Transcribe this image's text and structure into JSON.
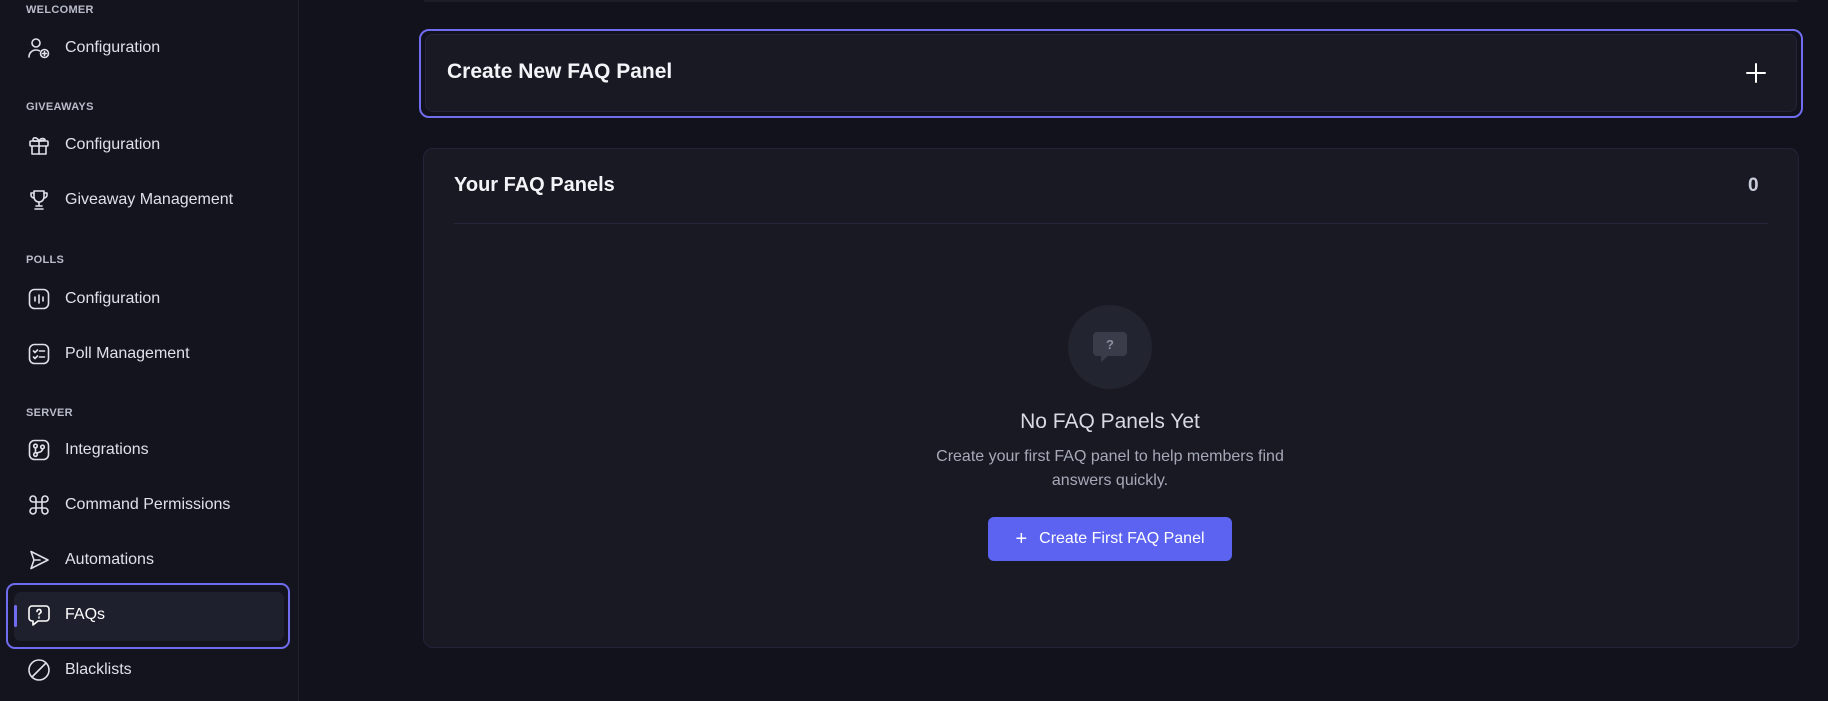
{
  "sidebar": {
    "sections": [
      {
        "label": "WELCOMER",
        "items": [
          {
            "label": "Configuration",
            "icon": "user-plus-icon"
          }
        ]
      },
      {
        "label": "GIVEAWAYS",
        "items": [
          {
            "label": "Configuration",
            "icon": "gift-icon"
          },
          {
            "label": "Giveaway Management",
            "icon": "trophy-icon"
          }
        ]
      },
      {
        "label": "POLLS",
        "items": [
          {
            "label": "Configuration",
            "icon": "poll-icon"
          },
          {
            "label": "Poll Management",
            "icon": "checklist-icon"
          }
        ]
      },
      {
        "label": "SERVER",
        "items": [
          {
            "label": "Integrations",
            "icon": "git-branch-icon"
          },
          {
            "label": "Command Permissions",
            "icon": "command-icon"
          },
          {
            "label": "Automations",
            "icon": "send-icon"
          },
          {
            "label": "FAQs",
            "icon": "faq-bubble-icon",
            "active": true
          },
          {
            "label": "Blacklists",
            "icon": "ban-icon"
          }
        ]
      }
    ]
  },
  "main": {
    "create_panel": {
      "title": "Create New FAQ Panel",
      "action_icon": "plus-icon"
    },
    "panels": {
      "title": "Your FAQ Panels",
      "count": "0",
      "empty_state": {
        "icon": "question-bubble-icon",
        "title": "No FAQ Panels Yet",
        "description_line1": "Create your first FAQ panel to help members find",
        "description_line2": "answers quickly.",
        "button_label": "Create First FAQ Panel"
      }
    }
  },
  "colors": {
    "accent": "#5b63f0",
    "outline": "#6f6cf0",
    "background": "#11121b"
  }
}
